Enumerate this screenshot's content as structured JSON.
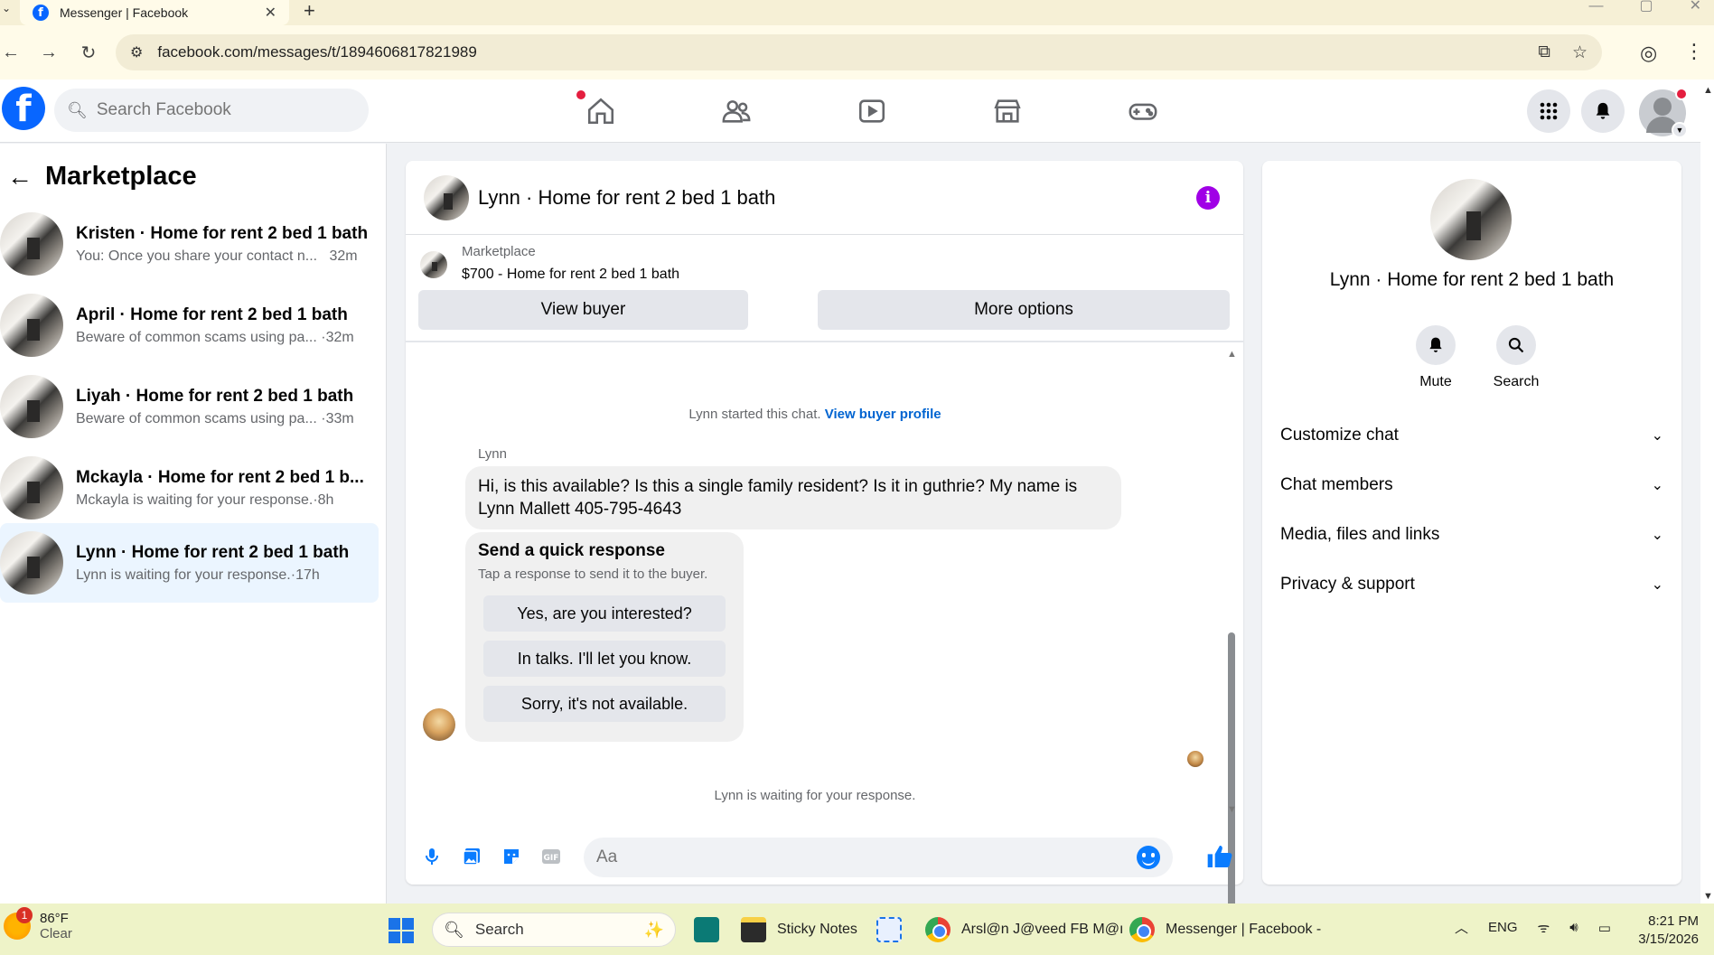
{
  "browser": {
    "tab_title": "Messenger | Facebook",
    "url": "facebook.com/messages/t/1894606817821989"
  },
  "fbnav": {
    "search_placeholder": "Search Facebook"
  },
  "sidebar": {
    "title": "Marketplace",
    "conversations": [
      {
        "name": "Kristen · Home for rent 2 bed 1 bath",
        "snippet": "You: Once you share your contact n...",
        "time": "32m",
        "active": false
      },
      {
        "name": "April · Home for rent 2 bed 1 bath",
        "snippet": "Beware of common scams using pa...",
        "time": "·32m",
        "active": false
      },
      {
        "name": "Liyah · Home for rent 2 bed 1 bath",
        "snippet": "Beware of common scams using pa...",
        "time": "·33m",
        "active": false
      },
      {
        "name": "Mckayla · Home for rent 2 bed 1 b...",
        "snippet": "Mckayla is waiting for your response.",
        "time": "·8h",
        "active": false
      },
      {
        "name": "Lynn · Home for rent 2 bed 1 bath",
        "snippet": "Lynn is waiting for your response.",
        "time": "·17h",
        "active": true
      }
    ]
  },
  "chat": {
    "title": "Lynn · Home for rent 2 bed 1 bath",
    "marketplace_label": "Marketplace",
    "listing": "$700 - Home for rent 2 bed 1 bath",
    "view_buyer": "View buyer",
    "more_options": "More options",
    "started_text": "Lynn started this chat.",
    "view_buyer_profile": "View buyer profile",
    "sender": "Lynn",
    "message": "Hi, is this available? Is this a single family resident? Is it in guthrie? My name is Lynn Mallett 405-795-4643",
    "quick_title": "Send a quick response",
    "quick_sub": "Tap a response to send it to the buyer.",
    "quick_responses": [
      "Yes, are you interested?",
      "In talks. I'll let you know.",
      "Sorry, it's not available."
    ],
    "waiting": "Lynn is waiting for your response.",
    "composer_placeholder": "Aa"
  },
  "right_panel": {
    "name": "Lynn · Home for rent 2 bed 1 bath",
    "mute": "Mute",
    "search": "Search",
    "sections": [
      "Customize chat",
      "Chat members",
      "Media, files and links",
      "Privacy & support"
    ]
  },
  "taskbar": {
    "temp": "86°F",
    "condition": "Clear",
    "weather_badge": "1",
    "search": "Search",
    "sticky_notes": "Sticky Notes",
    "chrome1": "Arsl@n J@veed FB M@ı",
    "chrome2": "Messenger | Facebook -",
    "lang": "ENG",
    "time": "8:21 PM",
    "date": "3/15/2026"
  },
  "colors": {
    "fb_blue": "#0866ff",
    "messenger_blue": "#0a7cff",
    "active_row": "#ebf5ff",
    "info_purple": "#a000e6"
  }
}
